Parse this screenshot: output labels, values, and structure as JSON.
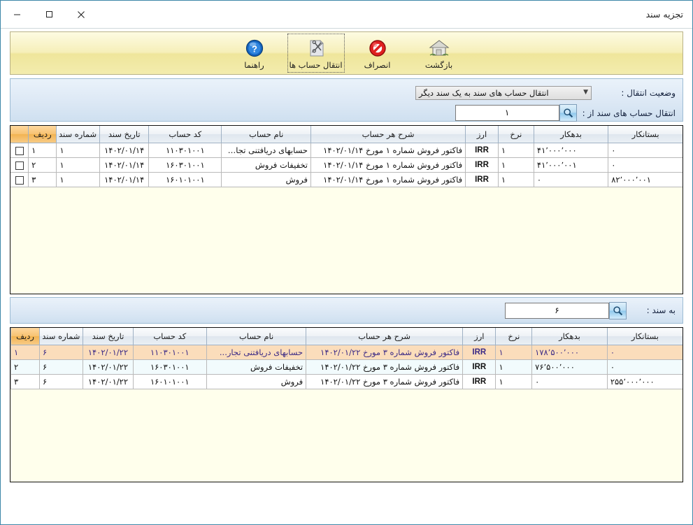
{
  "window": {
    "title": "تجزیه سند",
    "minimize_label": "—",
    "maximize_label": "□",
    "close_label": "✕"
  },
  "toolbar": {
    "buttons": [
      {
        "label": "راهنما",
        "icon": "help-question-icon",
        "focused": false
      },
      {
        "label": "انتقال حساب ها",
        "icon": "transfer-accounts-icon",
        "focused": true
      },
      {
        "label": "انصراف",
        "icon": "cancel-prohibited-icon",
        "focused": false
      },
      {
        "label": "بازگشت",
        "icon": "home-back-icon",
        "focused": false
      }
    ]
  },
  "transfer_panel": {
    "status_label": "وضعیت انتقال :",
    "status_value": "انتقال حساب های سند به یک سند دیگر",
    "from_label": "انتقال حساب های سند از :",
    "from_value": "۱",
    "search_icon": "magnifier-icon"
  },
  "to_panel": {
    "to_label": "به سند :",
    "to_value": "۶",
    "search_icon": "magnifier-icon"
  },
  "grid_headers": {
    "row_no": "ردیف",
    "doc_number": "شماره سند",
    "doc_date": "تاریخ سند",
    "account_code": "کد حساب",
    "account_name": "نام حساب",
    "description": "شرح هر حساب",
    "currency": "ارز",
    "rate": "نرخ",
    "debit": "بدهکار",
    "credit": "بستانکار",
    "select": ""
  },
  "source_grid": {
    "rows": [
      {
        "checked": false,
        "row_no": "۱",
        "doc_number": "۱",
        "doc_date": "۱۴۰۲/۰۱/۱۴",
        "account_code": "۱۱۰۳۰۱۰۰۱",
        "account_name": "حسابهای دریافتنی تجار...",
        "description": "فاکتور فروش شماره ۱ مورخ ۱۴۰۲/۰۱/۱۴",
        "currency": "IRR",
        "rate": "۱",
        "debit": "۴۱٬۰۰۰٬۰۰۰",
        "credit": "۰"
      },
      {
        "checked": false,
        "row_no": "۲",
        "doc_number": "۱",
        "doc_date": "۱۴۰۲/۰۱/۱۴",
        "account_code": "۱۶۰۳۰۱۰۰۱",
        "account_name": "تخفیفات فروش",
        "description": "فاکتور فروش شماره ۱ مورخ ۱۴۰۲/۰۱/۱۴",
        "currency": "IRR",
        "rate": "۱",
        "debit": "۴۱٬۰۰۰٬۰۰۱",
        "credit": "۰"
      },
      {
        "checked": false,
        "row_no": "۳",
        "doc_number": "۱",
        "doc_date": "۱۴۰۲/۰۱/۱۴",
        "account_code": "۱۶۰۱۰۱۰۰۱",
        "account_name": "فروش",
        "description": "فاکتور فروش شماره ۱ مورخ ۱۴۰۲/۰۱/۱۴",
        "currency": "IRR",
        "rate": "۱",
        "debit": "۰",
        "credit": "۸۲٬۰۰۰٬۰۰۱"
      }
    ]
  },
  "target_grid": {
    "rows": [
      {
        "selected": true,
        "row_no": "۱",
        "doc_number": "۶",
        "doc_date": "۱۴۰۲/۰۱/۲۲",
        "account_code": "۱۱۰۳۰۱۰۰۱",
        "account_name": "حسابهای دریافتنی تجار...",
        "description": "فاکتور فروش شماره ۳ مورخ ۱۴۰۲/۰۱/۲۲",
        "currency": "IRR",
        "rate": "۱",
        "debit": "۱۷۸٬۵۰۰٬۰۰۰",
        "credit": "۰"
      },
      {
        "selected": false,
        "row_no": "۲",
        "doc_number": "۶",
        "doc_date": "۱۴۰۲/۰۱/۲۲",
        "account_code": "۱۶۰۳۰۱۰۰۱",
        "account_name": "تخفیفات فروش",
        "description": "فاکتور فروش شماره ۳ مورخ ۱۴۰۲/۰۱/۲۲",
        "currency": "IRR",
        "rate": "۱",
        "debit": "۷۶٬۵۰۰٬۰۰۰",
        "credit": "۰"
      },
      {
        "selected": false,
        "row_no": "۳",
        "doc_number": "۶",
        "doc_date": "۱۴۰۲/۰۱/۲۲",
        "account_code": "۱۶۰۱۰۱۰۰۱",
        "account_name": "فروش",
        "description": "فاکتور فروش شماره ۳ مورخ ۱۴۰۲/۰۱/۲۲",
        "currency": "IRR",
        "rate": "۱",
        "debit": "۰",
        "credit": "۲۵۵٬۰۰۰٬۰۰۰"
      }
    ]
  },
  "colors": {
    "window_border": "#3d87a8",
    "toolbar_bg": "#f3ecae",
    "panel_bg": "#dfeaf6",
    "grid_bg": "#ffffec",
    "rowno_header": "#f2b451",
    "selected_row": "#fbddbb",
    "currency_text": "#17179c"
  }
}
